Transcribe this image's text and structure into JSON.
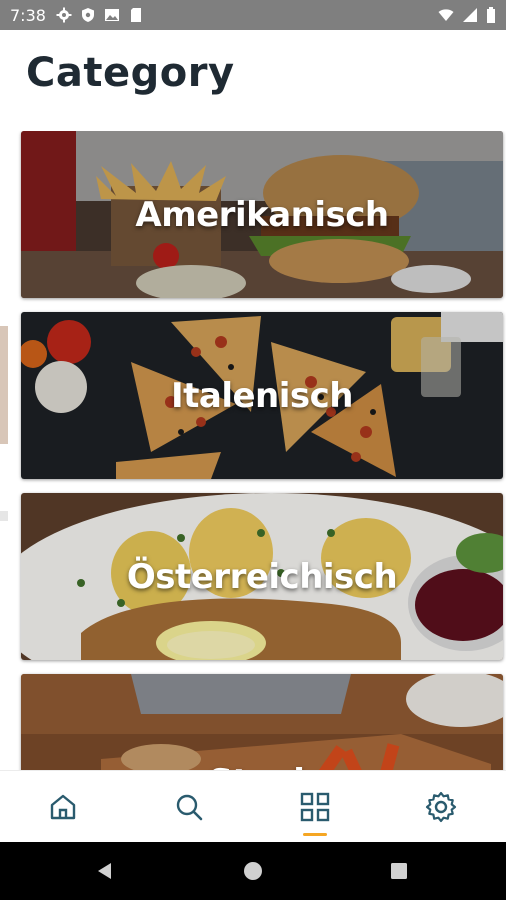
{
  "status_bar": {
    "time": "7:38",
    "left_icons": [
      "settings-icon",
      "shield-icon",
      "image-icon",
      "sd-card-icon"
    ],
    "right_icons": [
      "wifi-icon",
      "signal-icon",
      "battery-icon"
    ]
  },
  "page": {
    "title": "Category"
  },
  "categories": [
    {
      "label": "Amerikanisch",
      "image": "burger-and-fries-photo"
    },
    {
      "label": "Italenisch",
      "image": "pizza-slices-photo"
    },
    {
      "label": "Österreichisch",
      "image": "schnitzel-and-potatoes-photo"
    },
    {
      "label": "Steak",
      "image": "steak-platter-photo"
    }
  ],
  "bottom_nav": {
    "items": [
      {
        "icon": "home-icon"
      },
      {
        "icon": "search-icon"
      },
      {
        "icon": "grid-icon",
        "active": true
      },
      {
        "icon": "gear-icon"
      }
    ],
    "icon_color": "#2a5b6e",
    "active_indicator_color": "#f5a623"
  },
  "system_nav": [
    "back-icon",
    "home-circle-icon",
    "recents-icon"
  ]
}
